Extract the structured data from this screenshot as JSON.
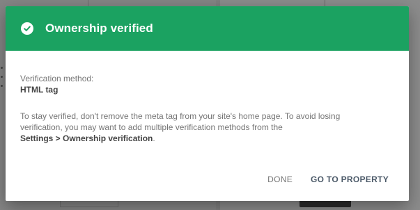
{
  "dialog": {
    "title": "Ownership verified",
    "method_label": "Verification method:",
    "method_value": "HTML tag",
    "info_text": "To stay verified, don't remove the meta tag from your site's home page. To avoid losing verification, you may want to add multiple verification methods from the",
    "info_path": "Settings > Ownership verification",
    "info_end": ".",
    "done_label": "DONE",
    "go_label": "GO TO PROPERTY"
  },
  "colors": {
    "header": "#1ba261",
    "overlay": "#7f7f7f"
  },
  "icons": {
    "header_icon": "check-circle-icon"
  }
}
